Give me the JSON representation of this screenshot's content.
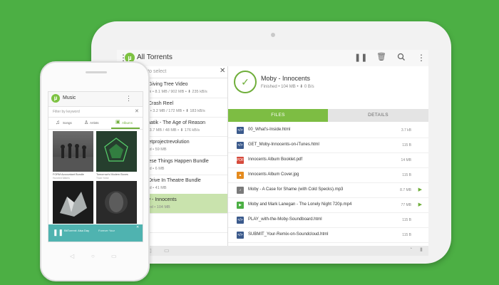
{
  "tablet": {
    "title": "All Torrents",
    "search_placeholder": "Tap to select",
    "torrents": [
      {
        "name": "The Giving Tree Video",
        "meta": "2h 23m  •  8.1 MB / 902 MB  •  ⬇ 235 kB/s",
        "selected": false
      },
      {
        "name": "The Crash Reel",
        "meta": "2h 0m  •  3.2 MB / 172 MB  •  ⬇ 183 kB/s",
        "selected": false
      },
      {
        "name": "Dramatik - The Age of Reason",
        "meta": "20m  •  3.7 MB / 48 MB  •  ⬇ 176 kB/s",
        "selected": false
      },
      {
        "name": "Secretprojectrevolution",
        "meta": "Paused  •  59 MB",
        "selected": false
      },
      {
        "name": "Chinese Things Happen Bundle",
        "meta": "Paused  •  6 MB",
        "selected": false
      },
      {
        "name": "The Drive In Theatre Bundle",
        "meta": "Paused  •  41 MB",
        "selected": false
      },
      {
        "name": "Moby - Innocents",
        "meta": "Finished  •  104 MB",
        "selected": true
      },
      {
        "name": "",
        "meta": "",
        "selected": false
      }
    ],
    "detail": {
      "name": "Moby - Innocents",
      "meta": "Finished  •  104 MB  •  ⬇ 0 B/s",
      "tab_files": "FILES",
      "tab_details": "DETAILS",
      "files": [
        {
          "name": "00_What's-Inside.html",
          "size": "3.7 kB",
          "type": "html",
          "play": false
        },
        {
          "name": "GET_Moby-Innocents-on-iTunes.html",
          "size": "115 B",
          "type": "html",
          "play": false
        },
        {
          "name": "Innocents Album Booklet.pdf",
          "size": "14 MB",
          "type": "pdf",
          "play": false
        },
        {
          "name": "Innocents Album Cover.jpg",
          "size": "115 B",
          "type": "img",
          "play": false
        },
        {
          "name": "Moby - A Case for Shame (with Cold Specks).mp3",
          "size": "8.7 MB",
          "type": "audio",
          "play": true
        },
        {
          "name": "Moby and Mark Lanegan - The Lonely Night 720p.mp4",
          "size": "77 MB",
          "type": "video",
          "play": true
        },
        {
          "name": "PLAY_with-the-Moby-Soundboard.html",
          "size": "115 B",
          "type": "html",
          "play": false
        },
        {
          "name": "SUBMIT_Your-Remix-on-Soundcloud.html",
          "size": "115 B",
          "type": "html",
          "play": false
        }
      ]
    }
  },
  "phone": {
    "title": "Music",
    "filter_placeholder": "Filter by keyword",
    "tabs": [
      "Songs",
      "Artists",
      "Albums"
    ],
    "albums": [
      {
        "title": "FORM Accountant Bundle",
        "artist": "Hundred Waters"
      },
      {
        "title": "Tomorrow's Modern Boxes",
        "artist": "Thom Yorke"
      },
      {
        "title": "",
        "artist": ""
      },
      {
        "title": "",
        "artist": ""
      }
    ],
    "player": {
      "track": "BitTorrent: Alsa Day",
      "artist": "Forever Your"
    }
  },
  "colors": {
    "accent": "#6fae3a",
    "background": "#4caf44",
    "selected": "#c9e3ad",
    "files_tab": "#7dbd43",
    "player": "#4fb3b0"
  }
}
